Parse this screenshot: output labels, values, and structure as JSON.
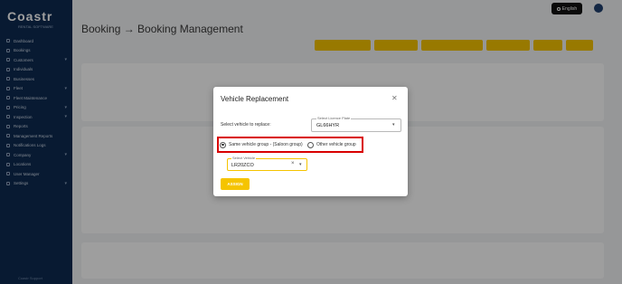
{
  "sidebar": {
    "logo": "Coastr",
    "logo_sub": "RENTAL SOFTWARE",
    "items": [
      {
        "label": "Dashboard",
        "has_sub": false
      },
      {
        "label": "Bookings",
        "has_sub": false
      },
      {
        "label": "Customers",
        "has_sub": true
      },
      {
        "label": "Individuals",
        "has_sub": false
      },
      {
        "label": "Businesses",
        "has_sub": false
      },
      {
        "label": "Fleet",
        "has_sub": true
      },
      {
        "label": "Fleet Maintenance",
        "has_sub": false
      },
      {
        "label": "Pricing",
        "has_sub": true
      },
      {
        "label": "Inspection",
        "has_sub": true
      },
      {
        "label": "Reports",
        "has_sub": false
      },
      {
        "label": "Management Reports",
        "has_sub": false
      },
      {
        "label": "Notifications Logs",
        "has_sub": false
      },
      {
        "label": "Company",
        "has_sub": true
      },
      {
        "label": "Locations",
        "has_sub": false
      },
      {
        "label": "User Manager",
        "has_sub": false
      },
      {
        "label": "Settings",
        "has_sub": true
      }
    ],
    "footer": "Coastr Support"
  },
  "header": {
    "language": "English"
  },
  "page": {
    "title": "Booking → Booking Management"
  },
  "modal": {
    "title": "Vehicle Replacement",
    "select_label": "Select vehicle to replace:",
    "license_plate": {
      "label": "Select Licence Plate",
      "value": "GL66HYR"
    },
    "options": [
      {
        "label": "Same vehicle group - (Saloon group)",
        "selected": true
      },
      {
        "label": "Other vehicle group",
        "selected": false
      }
    ],
    "vehicle": {
      "label": "Select Vehicle",
      "value": "LR20ZCO"
    },
    "assign_label": "ASSIGN"
  },
  "colors": {
    "accent": "#f5c400",
    "sidebar": "#0d2b52",
    "highlight": "#d90000"
  }
}
